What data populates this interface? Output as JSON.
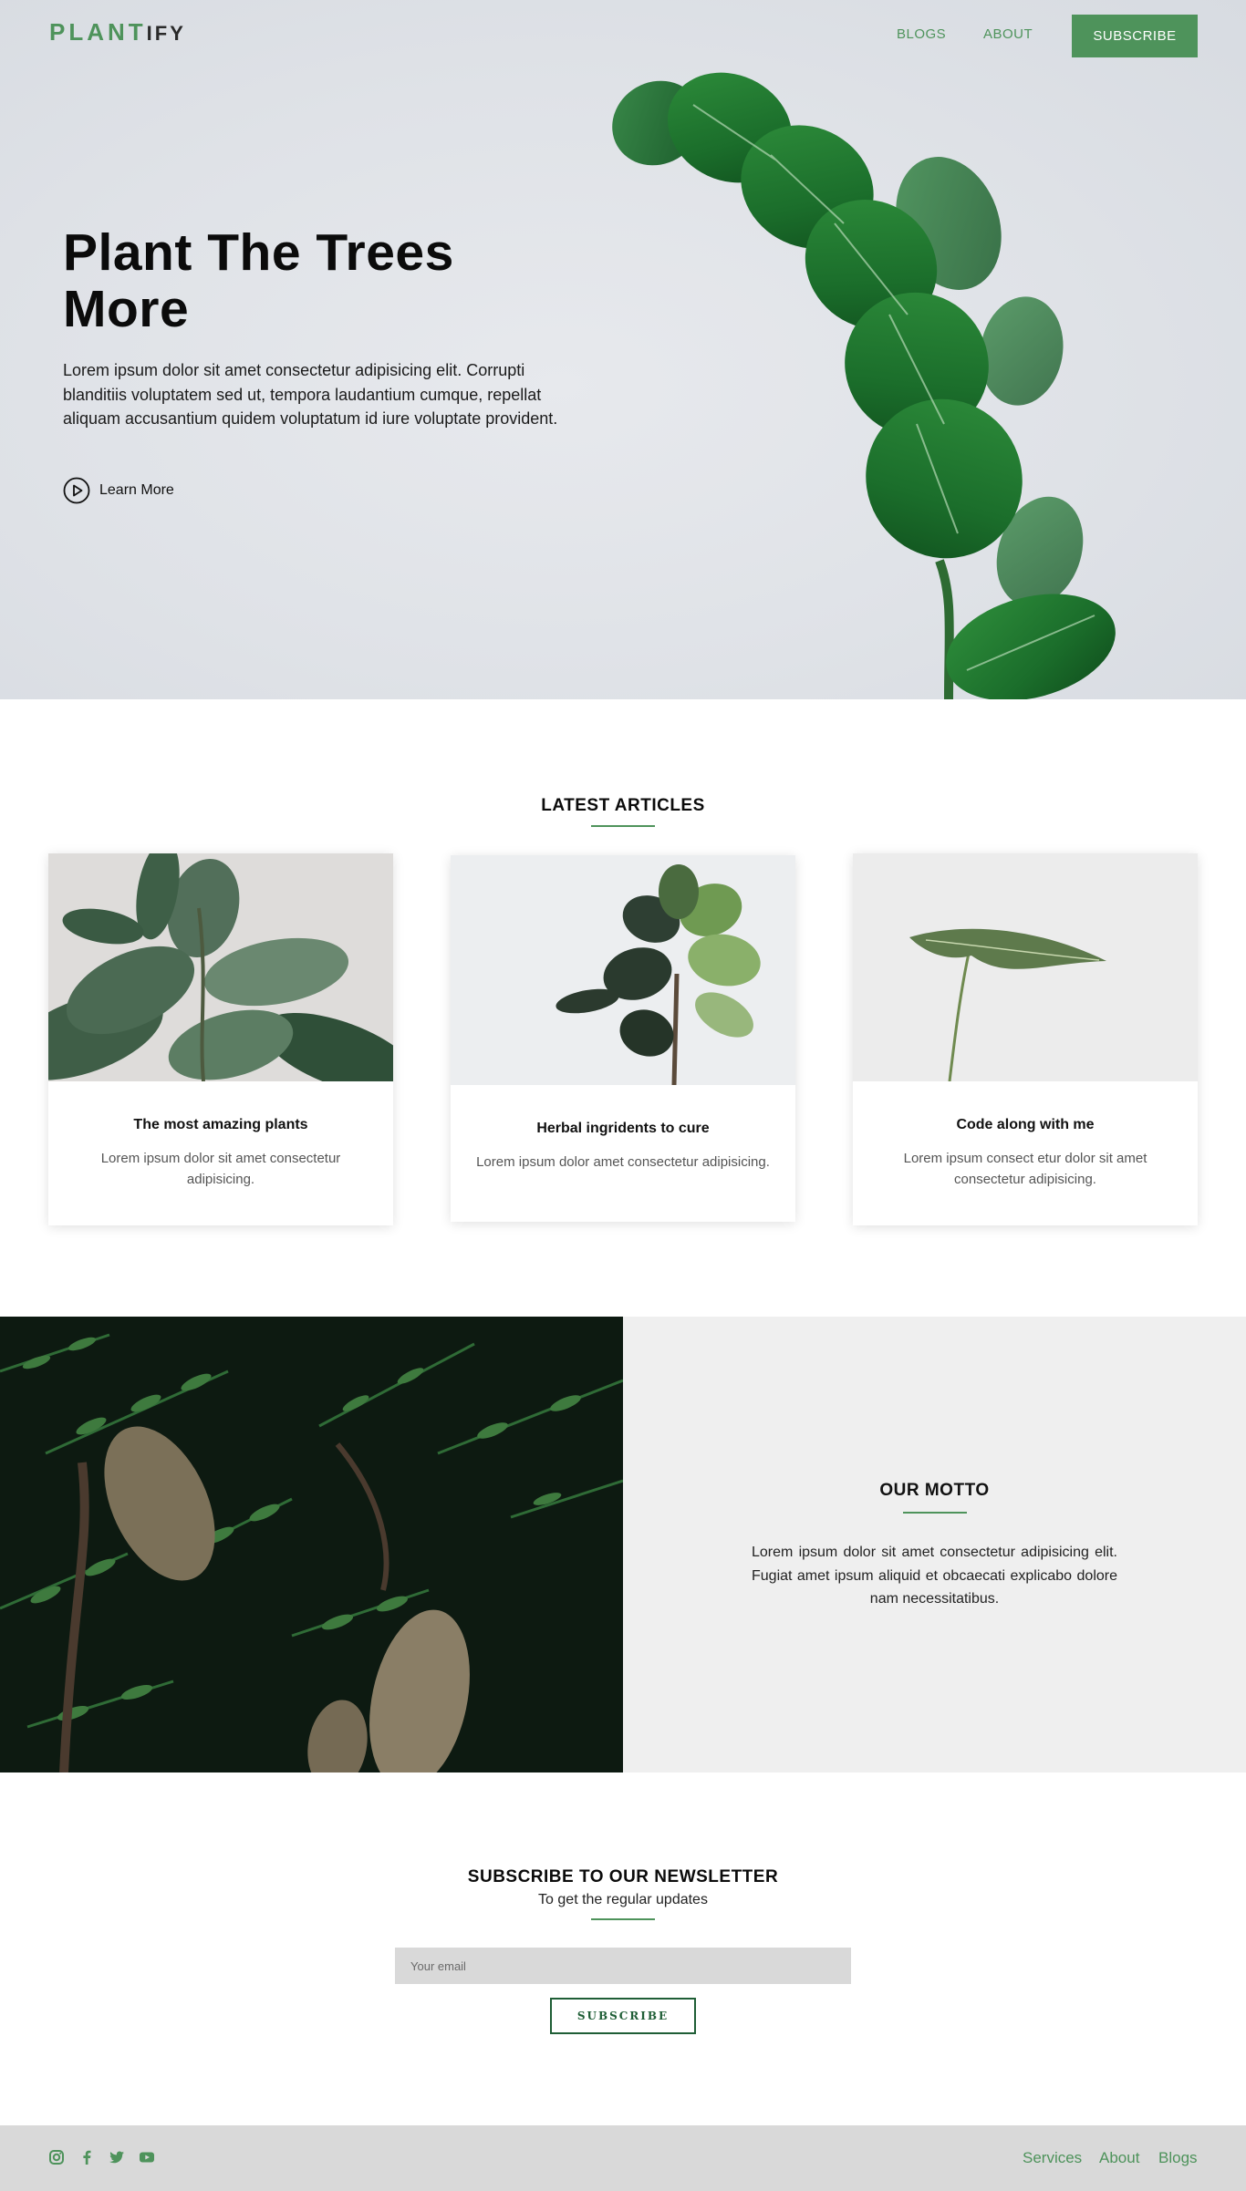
{
  "brand": {
    "part1": "PLANT",
    "part2": "IFY",
    "accent_color": "#4e935b"
  },
  "nav": {
    "blogs": "BLOGS",
    "about": "ABOUT",
    "subscribe": "SUBSCRIBE"
  },
  "hero": {
    "title": "Plant The Trees More",
    "text": "Lorem ipsum dolor sit amet consectetur adipisicing elit. Corrupti blanditiis voluptatem sed ut, tempora laudantium cumque, repellat aliquam accusantium quidem voluptatum id iure voluptate provident.",
    "learn_more": "Learn More",
    "learn_more_icon": "play-circle-icon"
  },
  "articles": {
    "heading": "LATEST ARTICLES",
    "items": [
      {
        "title": "The most amazing plants",
        "desc": "Lorem ipsum dolor sit amet consectetur adipisicing."
      },
      {
        "title": "Herbal ingridents to cure",
        "desc": "Lorem ipsum dolor amet consectetur adipisicing."
      },
      {
        "title": "Code along with me",
        "desc": "Lorem ipsum consect etur dolor sit amet consectetur adipisicing."
      }
    ]
  },
  "motto": {
    "heading": "OUR MOTTO",
    "text": "Lorem ipsum dolor sit amet consectetur adipisicing elit. Fugiat amet ipsum aliquid et obcaecati explicabo dolore nam necessitatibus."
  },
  "newsletter": {
    "heading": "SUBSCRIBE TO OUR NEWSLETTER",
    "subheading": "To get the regular updates",
    "placeholder": "Your email",
    "button": "SUBSCRIBE"
  },
  "footer": {
    "social_icons": [
      "instagram-icon",
      "facebook-icon",
      "twitter-icon",
      "youtube-icon"
    ],
    "links": {
      "services": "Services",
      "about": "About",
      "blogs": "Blogs"
    }
  }
}
